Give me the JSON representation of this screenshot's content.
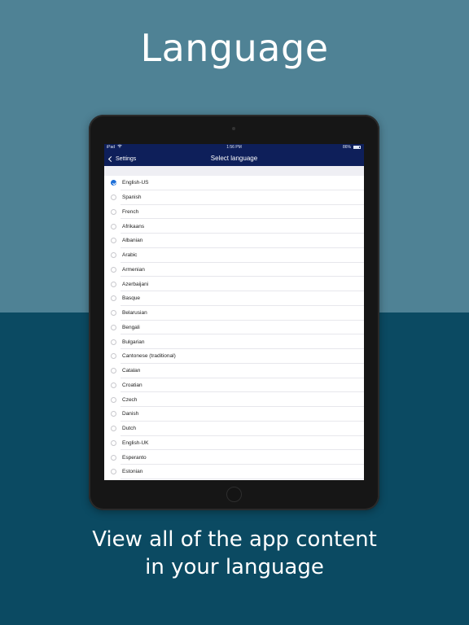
{
  "headline": "Language",
  "tagline": [
    "View all of the app content",
    "in your language"
  ],
  "status_bar": {
    "device": "iPad",
    "time": "1:56 PM",
    "battery": "86%"
  },
  "navbar": {
    "back_label": "Settings",
    "title": "Select language"
  },
  "languages": [
    {
      "label": "English-US",
      "selected": true
    },
    {
      "label": "Spanish",
      "selected": false
    },
    {
      "label": "French",
      "selected": false
    },
    {
      "label": "Afrikaans",
      "selected": false
    },
    {
      "label": "Albanian",
      "selected": false
    },
    {
      "label": "Arabic",
      "selected": false
    },
    {
      "label": "Armenian",
      "selected": false
    },
    {
      "label": "Azerbaijani",
      "selected": false
    },
    {
      "label": "Basque",
      "selected": false
    },
    {
      "label": "Belarusian",
      "selected": false
    },
    {
      "label": "Bengali",
      "selected": false
    },
    {
      "label": "Bulgarian",
      "selected": false
    },
    {
      "label": "Cantonese (traditional)",
      "selected": false
    },
    {
      "label": "Catalan",
      "selected": false
    },
    {
      "label": "Croatian",
      "selected": false
    },
    {
      "label": "Czech",
      "selected": false
    },
    {
      "label": "Danish",
      "selected": false
    },
    {
      "label": "Dutch",
      "selected": false
    },
    {
      "label": "English-UK",
      "selected": false
    },
    {
      "label": "Esperanto",
      "selected": false
    },
    {
      "label": "Estonian",
      "selected": false
    }
  ],
  "colors": {
    "background_top": "#4f8295",
    "background_bottom": "#0b4a62",
    "navbar": "#0e1f5a",
    "accent": "#1d6fd8"
  },
  "icons": {
    "back": "chevron-left-icon",
    "wifi": "wifi-icon",
    "battery": "battery-icon",
    "selected": "checkmark-circle-icon"
  }
}
